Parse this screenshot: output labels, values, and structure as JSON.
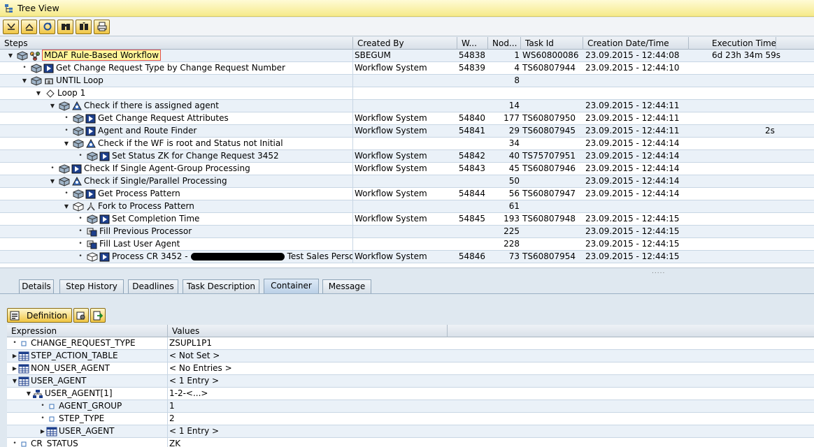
{
  "window": {
    "title": "Tree View"
  },
  "toolbar": {
    "buttons": [
      "expand-all-icon",
      "collapse-all-icon",
      "refresh-icon",
      "find-icon",
      "find-next-icon",
      "print-icon"
    ]
  },
  "tree": {
    "columns": [
      "Steps",
      "Created By",
      "W...",
      "Nod...",
      "Task Id",
      "Creation Date/Time",
      "Execution Time"
    ],
    "rows": [
      {
        "indent": 0,
        "exp": "down",
        "icons": [
          "cube",
          "workflow"
        ],
        "step": "MDAF Rule-Based Workflow",
        "highlight": true,
        "created_by": "SBEGUM",
        "wi": "54838",
        "node": "1",
        "task": "WS60800086",
        "date": "23.09.2015 - 12:44:08",
        "exec": "6d 23h 34m 59s"
      },
      {
        "indent": 1,
        "exp": "dot",
        "icons": [
          "cube",
          "task"
        ],
        "step": "Get Change Request Type by Change Request Number",
        "created_by": "Workflow System",
        "wi": "54839",
        "node": "4",
        "task": "TS60807944",
        "date": "23.09.2015 - 12:44:10",
        "exec": ""
      },
      {
        "indent": 1,
        "exp": "down",
        "icons": [
          "cube",
          "loop"
        ],
        "step": "UNTIL Loop",
        "created_by": "",
        "wi": "",
        "node": "8",
        "task": "",
        "date": "",
        "exec": ""
      },
      {
        "indent": 2,
        "exp": "down",
        "icons": [
          "diamond"
        ],
        "step": "Loop 1",
        "created_by": "",
        "wi": "",
        "node": "",
        "task": "",
        "date": "",
        "exec": ""
      },
      {
        "indent": 3,
        "exp": "down",
        "icons": [
          "cube",
          "condition"
        ],
        "step": "Check if there is assigned agent",
        "created_by": "",
        "wi": "",
        "node": "14",
        "task": "",
        "date": "23.09.2015 - 12:44:11",
        "exec": ""
      },
      {
        "indent": 4,
        "exp": "dot",
        "icons": [
          "cube",
          "task"
        ],
        "step": "Get Change Request Attributes",
        "created_by": "Workflow System",
        "wi": "54840",
        "node": "177",
        "task": "TS60807950",
        "date": "23.09.2015 - 12:44:11",
        "exec": ""
      },
      {
        "indent": 4,
        "exp": "dot",
        "icons": [
          "cube",
          "task"
        ],
        "step": "Agent and Route Finder",
        "created_by": "Workflow System",
        "wi": "54841",
        "node": "29",
        "task": "TS60807945",
        "date": "23.09.2015 - 12:44:11",
        "exec": "2s"
      },
      {
        "indent": 4,
        "exp": "down",
        "icons": [
          "cube",
          "condition"
        ],
        "step": "Check if the WF is root and Status not Initial",
        "created_by": "",
        "wi": "",
        "node": "34",
        "task": "",
        "date": "23.09.2015 - 12:44:14",
        "exec": ""
      },
      {
        "indent": 5,
        "exp": "dot",
        "icons": [
          "cube",
          "task"
        ],
        "step": "Set Status ZK for Change Request 3452",
        "created_by": "Workflow System",
        "wi": "54842",
        "node": "40",
        "task": "TS75707951",
        "date": "23.09.2015 - 12:44:14",
        "exec": ""
      },
      {
        "indent": 3,
        "exp": "dot",
        "icons": [
          "cube",
          "task"
        ],
        "step": "Check If Single Agent-Group Processing",
        "created_by": "Workflow System",
        "wi": "54843",
        "node": "45",
        "task": "TS60807946",
        "date": "23.09.2015 - 12:44:14",
        "exec": ""
      },
      {
        "indent": 3,
        "exp": "down",
        "icons": [
          "cube",
          "condition"
        ],
        "step": "Check if Single/Parallel Processing",
        "created_by": "",
        "wi": "",
        "node": "50",
        "task": "",
        "date": "23.09.2015 - 12:44:14",
        "exec": ""
      },
      {
        "indent": 4,
        "exp": "dot",
        "icons": [
          "cube",
          "task"
        ],
        "step": "Get Process Pattern",
        "created_by": "Workflow System",
        "wi": "54844",
        "node": "56",
        "task": "TS60807947",
        "date": "23.09.2015 - 12:44:14",
        "exec": ""
      },
      {
        "indent": 4,
        "exp": "down",
        "icons": [
          "cube-outline",
          "fork"
        ],
        "step": "Fork to Process Pattern",
        "created_by": "",
        "wi": "",
        "node": "61",
        "task": "",
        "date": "",
        "exec": ""
      },
      {
        "indent": 5,
        "exp": "dot",
        "icons": [
          "cube",
          "task"
        ],
        "step": "Set Completion Time",
        "created_by": "Workflow System",
        "wi": "54845",
        "node": "193",
        "task": "TS60807948",
        "date": "23.09.2015 - 12:44:15",
        "exec": ""
      },
      {
        "indent": 5,
        "exp": "dot",
        "icons": [
          "container-op"
        ],
        "step": "Fill Previous Processor",
        "created_by": "",
        "wi": "",
        "node": "225",
        "task": "",
        "date": "23.09.2015 - 12:44:15",
        "exec": ""
      },
      {
        "indent": 5,
        "exp": "dot",
        "icons": [
          "container-op"
        ],
        "step": "Fill Last User Agent",
        "created_by": "",
        "wi": "",
        "node": "228",
        "task": "",
        "date": "23.09.2015 - 12:44:15",
        "exec": ""
      },
      {
        "indent": 5,
        "exp": "dot",
        "icons": [
          "cube-outline",
          "task"
        ],
        "step": "Process CR 3452 -",
        "step_tail": "Test Sales Person",
        "redacted": true,
        "created_by": "Workflow System",
        "wi": "54846",
        "node": "73",
        "task": "TS60807954",
        "date": "23.09.2015 - 12:44:15",
        "exec": ""
      }
    ]
  },
  "tabs": [
    {
      "label": "Details",
      "active": false
    },
    {
      "label": "Step History",
      "active": false
    },
    {
      "label": "Deadlines",
      "active": false
    },
    {
      "label": "Task Description",
      "active": false
    },
    {
      "label": "Container",
      "active": true
    },
    {
      "label": "Message",
      "active": false
    }
  ],
  "container": {
    "definition_label": "Definition",
    "columns": [
      "Expression",
      "Values"
    ],
    "rows": [
      {
        "indent": 0,
        "exp": "dot",
        "icon": "element",
        "name": "CHANGE_REQUEST_TYPE",
        "value": "ZSUPL1P1"
      },
      {
        "indent": 0,
        "exp": "right",
        "icon": "table",
        "name": "STEP_ACTION_TABLE",
        "value": "< Not Set >"
      },
      {
        "indent": 0,
        "exp": "right",
        "icon": "table",
        "name": "NON_USER_AGENT",
        "value": "< No Entries >"
      },
      {
        "indent": 0,
        "exp": "down",
        "icon": "table",
        "name": "USER_AGENT",
        "value": "< 1 Entry >"
      },
      {
        "indent": 1,
        "exp": "down",
        "icon": "structure",
        "name": "USER_AGENT[1]",
        "value": "1-2-<...>"
      },
      {
        "indent": 2,
        "exp": "dot",
        "icon": "element",
        "name": "AGENT_GROUP",
        "value": "1"
      },
      {
        "indent": 2,
        "exp": "dot",
        "icon": "element",
        "name": "STEP_TYPE",
        "value": "2"
      },
      {
        "indent": 2,
        "exp": "right",
        "icon": "table",
        "name": "USER_AGENT",
        "value": "< 1 Entry >"
      },
      {
        "indent": 0,
        "exp": "dot",
        "icon": "element",
        "name": "CR_STATUS",
        "value": "ZK"
      }
    ]
  },
  "colors": {
    "title_bg": "#f6ea8a",
    "row_alt": "#eaf1f8",
    "button_gold": "#f0c542",
    "highlight_box": "#e05050"
  }
}
